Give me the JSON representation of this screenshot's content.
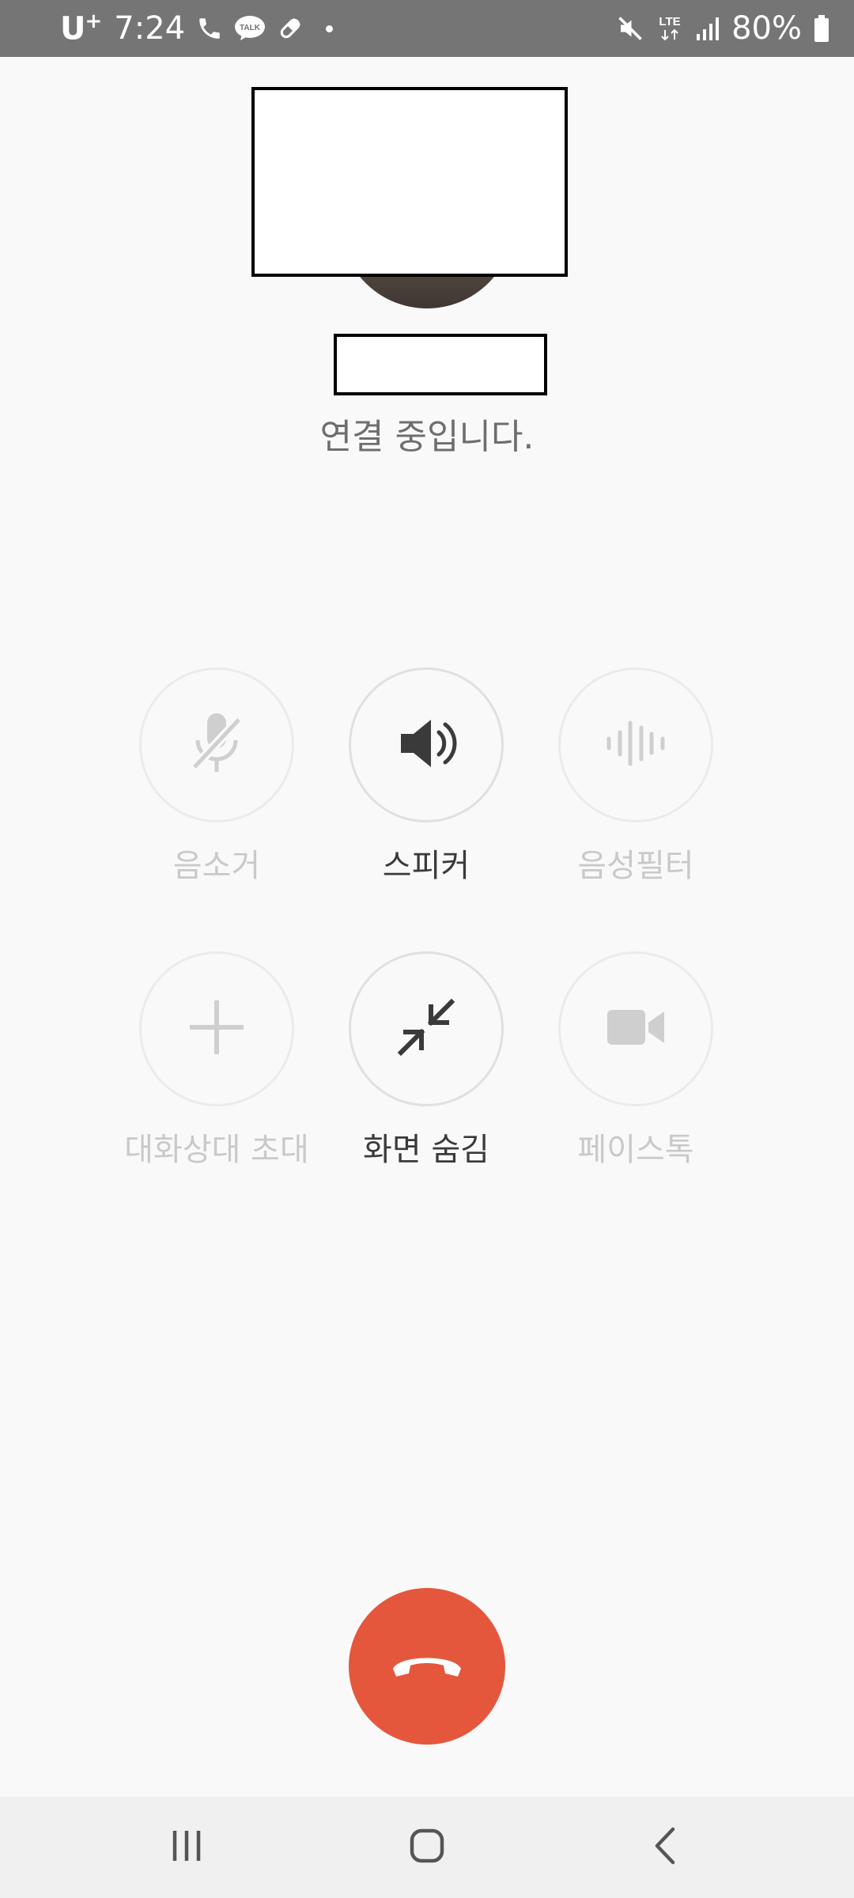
{
  "status_bar": {
    "carrier": "U",
    "carrier_sup": "+",
    "time": "7:24",
    "notification_icons": [
      "phone-icon",
      "kakaotalk-icon",
      "pill-icon",
      "dot-icon"
    ],
    "talk_badge": "TALK",
    "network": "LTE",
    "battery_percent": "80%",
    "status_icons": [
      "mute-icon",
      "lte-icon",
      "signal-icon",
      "battery-icon"
    ]
  },
  "call": {
    "status_text": "연결 중입니다."
  },
  "controls": [
    {
      "id": "mute",
      "label": "음소거",
      "icon": "mic-off-icon",
      "enabled": false
    },
    {
      "id": "speaker",
      "label": "스피커",
      "icon": "speaker-icon",
      "enabled": true
    },
    {
      "id": "voice-filter",
      "label": "음성필터",
      "icon": "voice-filter-icon",
      "enabled": false
    },
    {
      "id": "invite",
      "label": "대화상대 초대",
      "icon": "plus-icon",
      "enabled": false
    },
    {
      "id": "hide-screen",
      "label": "화면 숨김",
      "icon": "minimize-icon",
      "enabled": true
    },
    {
      "id": "facetalk",
      "label": "페이스톡",
      "icon": "video-camera-icon",
      "enabled": false
    }
  ],
  "end_call": {
    "icon": "hang-up-icon",
    "color": "#e4573d"
  },
  "nav_bar": {
    "items": [
      "recent-apps-icon",
      "home-icon",
      "back-icon"
    ]
  },
  "colors": {
    "status_bar": "#757575",
    "background": "#f9f9f9",
    "active_text": "#3a3a3a",
    "disabled_text": "#c9c9c9"
  }
}
